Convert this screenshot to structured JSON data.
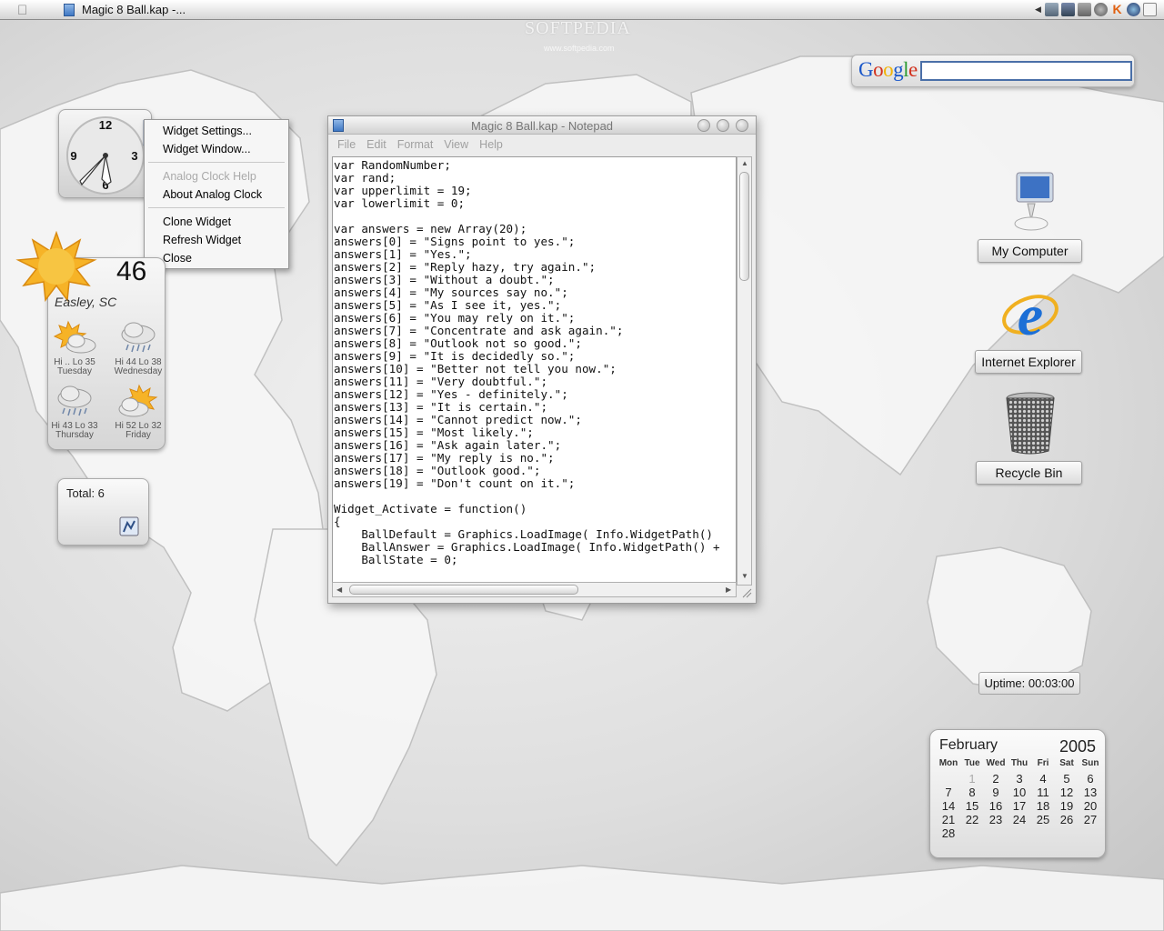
{
  "menubar": {
    "title": "Magic 8 Ball.kap -...",
    "watermark": "SOFTPEDIA",
    "watermark_sub": "www.softpedia.com",
    "tray_icons": [
      "arrow-left-icon",
      "network-icon",
      "monitor-icon",
      "system-icon",
      "sound-icon",
      "k-icon",
      "globe-icon",
      "accessibility-icon"
    ]
  },
  "google": {
    "logo": "Google",
    "query": ""
  },
  "clock": {
    "numerals": [
      "12",
      "3",
      "6",
      "9"
    ]
  },
  "context_menu": {
    "items": [
      {
        "label": "Widget Settings...",
        "enabled": true
      },
      {
        "label": "Widget Window...",
        "enabled": true
      },
      {
        "label": "Analog Clock Help",
        "enabled": false
      },
      {
        "label": "About Analog Clock",
        "enabled": true
      },
      {
        "label": "Clone Widget",
        "enabled": true
      },
      {
        "label": "Refresh Widget",
        "enabled": true
      },
      {
        "label": "Close",
        "enabled": true
      }
    ]
  },
  "weather": {
    "current_temp": "46",
    "city": "Easley, SC",
    "forecast": [
      {
        "hilo": "Hi .. Lo 35",
        "day": "Tuesday",
        "icon": "partly-cloudy-icon"
      },
      {
        "hilo": "Hi 44 Lo 38",
        "day": "Wednesday",
        "icon": "rain-icon"
      },
      {
        "hilo": "Hi 43 Lo 33",
        "day": "Thursday",
        "icon": "rain-icon"
      },
      {
        "hilo": "Hi 52 Lo 32",
        "day": "Friday",
        "icon": "partly-cloudy-icon"
      }
    ]
  },
  "total": {
    "label": "Total: 6"
  },
  "notepad": {
    "title": "Magic 8 Ball.kap - Notepad",
    "menus": [
      "File",
      "Edit",
      "Format",
      "View",
      "Help"
    ],
    "code": "var RandomNumber;\nvar rand;\nvar upperlimit = 19;\nvar lowerlimit = 0;\n\nvar answers = new Array(20);\nanswers[0] = \"Signs point to yes.\";\nanswers[1] = \"Yes.\";\nanswers[2] = \"Reply hazy, try again.\";\nanswers[3] = \"Without a doubt.\";\nanswers[4] = \"My sources say no.\";\nanswers[5] = \"As I see it, yes.\";\nanswers[6] = \"You may rely on it.\";\nanswers[7] = \"Concentrate and ask again.\";\nanswers[8] = \"Outlook not so good.\";\nanswers[9] = \"It is decidedly so.\";\nanswers[10] = \"Better not tell you now.\";\nanswers[11] = \"Very doubtful.\";\nanswers[12] = \"Yes - definitely.\";\nanswers[13] = \"It is certain.\";\nanswers[14] = \"Cannot predict now.\";\nanswers[15] = \"Most likely.\";\nanswers[16] = \"Ask again later.\";\nanswers[17] = \"My reply is no.\";\nanswers[18] = \"Outlook good.\";\nanswers[19] = \"Don't count on it.\";\n\nWidget_Activate = function()\n{\n    BallDefault = Graphics.LoadImage( Info.WidgetPath()\n    BallAnswer = Graphics.LoadImage( Info.WidgetPath() +\n    BallState = 0;"
  },
  "desktop": {
    "my_computer": "My Computer",
    "internet_explorer": "Internet Explorer",
    "recycle_bin": "Recycle Bin"
  },
  "uptime": {
    "label": "Uptime: 00:03:00"
  },
  "calendar": {
    "month": "February",
    "year": "2005",
    "weekdays": [
      "Mon",
      "Tue",
      "Wed",
      "Thu",
      "Fri",
      "Sat",
      "Sun"
    ],
    "days": [
      "",
      "1",
      "2",
      "3",
      "4",
      "5",
      "6",
      "7",
      "8",
      "9",
      "10",
      "11",
      "12",
      "13",
      "14",
      "15",
      "16",
      "17",
      "18",
      "19",
      "20",
      "21",
      "22",
      "23",
      "24",
      "25",
      "26",
      "27",
      "28"
    ],
    "today": "1"
  },
  "colors": {
    "selection_border": "#4a6fa8",
    "sun": "#f4a21a",
    "ie_blue": "#1c6fd6"
  }
}
